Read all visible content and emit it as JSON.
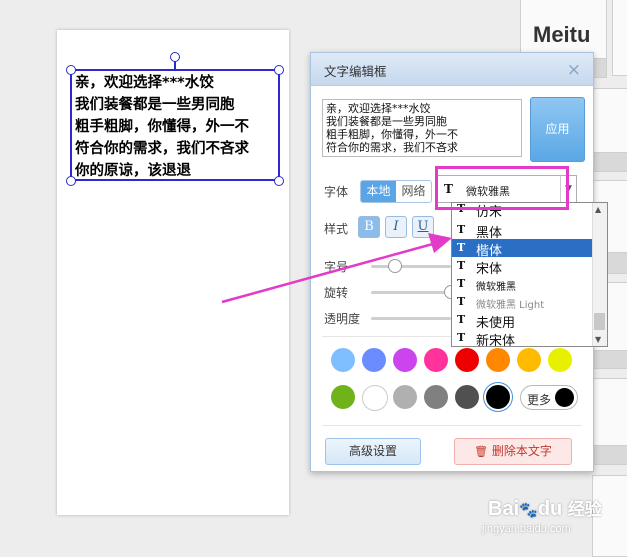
{
  "canvas": {
    "text": "亲，欢迎选择***水饺\n我们装餐都是一些男同胞\n粗手粗脚，你懂得，外一不\n符合你的需求，我们不吝求\n你的原谅，该退退"
  },
  "thumbnails": {
    "meitu_label": "Meitu"
  },
  "dialog": {
    "title": "文字编辑框",
    "close_icon": "×",
    "text_value": "亲，欢迎选择***水饺\n我们装餐都是一些男同胞\n粗手粗脚，你懂得，外一不\n符合你的需求，我们不吝求",
    "apply_label": "应用",
    "font_label": "字体",
    "font_source": {
      "local": "本地",
      "web": "网络",
      "selected": "本地"
    },
    "font_select_value": "微软雅黑",
    "font_icon": "T",
    "style_label": "样式",
    "style_buttons": {
      "bold": "B",
      "italic": "I",
      "underline": "U"
    },
    "size_label": "字号",
    "rotate_label": "旋转",
    "opacity_label": "透明度",
    "colors": [
      "#7fbfff",
      "#6b8cff",
      "#cc44ee",
      "#ff3399",
      "#ee0000",
      "#ff8800",
      "#ffbb00",
      "#e8f000",
      "#6fb21a",
      "#ffffff",
      "#b0b0b0",
      "#808080",
      "#505050",
      "#000000"
    ],
    "more_label": "更多",
    "advanced_label": "高级设置",
    "delete_label": "删除本文字",
    "delete_icon": "🗑"
  },
  "font_dropdown": {
    "items": [
      "仿宋",
      "黑体",
      "楷体",
      "宋体",
      "微软雅黑",
      "微软雅黑 Light",
      "未使用",
      "新宋体"
    ],
    "selected": "楷体"
  },
  "annotation": {
    "arrow_color": "#e23ac9",
    "highlight_color": "#e23ac9"
  },
  "watermark": {
    "brand": "Bai",
    "brand2": "du",
    "suffix": "经验",
    "url": "jingyan.baidu.com"
  }
}
